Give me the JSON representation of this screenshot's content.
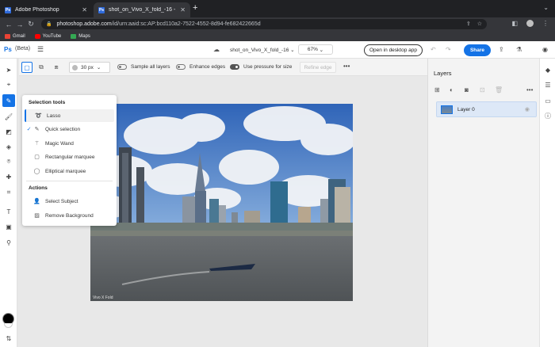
{
  "browser": {
    "tabs": [
      {
        "label": "Adobe Photoshop",
        "favicon": "Ps"
      },
      {
        "label": "shot_on_Vivo_X_fold_-16 - Ad",
        "favicon": "Ps"
      }
    ],
    "url_host": "photoshop.adobe.com",
    "url_path": "/id/urn:aaid:sc:AP:bcd110a2-7522-4552-8d94-fe682422665d",
    "bookmarks": [
      "Gmail",
      "YouTube",
      "Maps"
    ]
  },
  "header": {
    "app_logo": "Ps",
    "beta_label": "(Beta)",
    "document_name": "shot_on_Vivo_X_fold_-16",
    "zoom": "67%",
    "open_desktop_label": "Open in desktop app",
    "share_label": "Share"
  },
  "options": {
    "brush_size": "30 px",
    "sample_all_layers": "Sample all layers",
    "enhance_edges": "Enhance edges",
    "use_pressure": "Use pressure for size",
    "refine_edge": "Refine edge"
  },
  "flyout": {
    "section_selection": "Selection tools",
    "tools": [
      {
        "label": "Lasso",
        "icon": "lasso-icon"
      },
      {
        "label": "Quick selection",
        "icon": "quick-selection-icon"
      },
      {
        "label": "Magic Wand",
        "icon": "magic-wand-icon"
      },
      {
        "label": "Rectangular marquee",
        "icon": "rect-marquee-icon"
      },
      {
        "label": "Elliptical marquee",
        "icon": "ellipse-marquee-icon"
      }
    ],
    "section_actions": "Actions",
    "actions": [
      {
        "label": "Select Subject",
        "icon": "person-icon"
      },
      {
        "label": "Remove Background",
        "icon": "remove-bg-icon"
      }
    ]
  },
  "layers": {
    "title": "Layers",
    "items": [
      {
        "name": "Layer 0"
      }
    ]
  },
  "photo": {
    "watermark": "Vivo X Fold"
  },
  "colors": {
    "accent": "#1473e6",
    "foreground": "#000000",
    "background": "#ffffff"
  }
}
